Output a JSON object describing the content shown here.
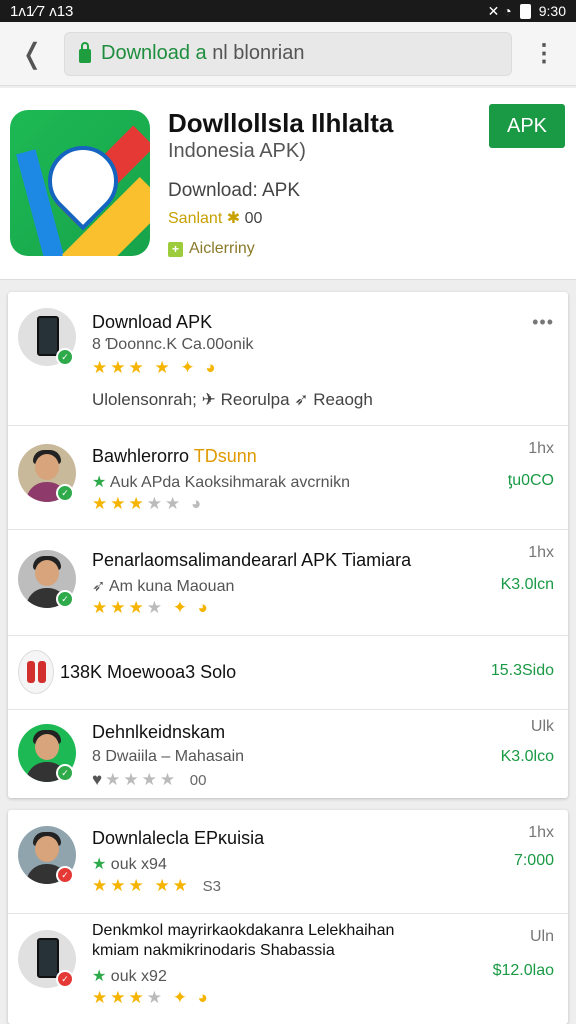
{
  "status": {
    "left": "1ʌ1∕7 ʌ13",
    "time": "9:30",
    "icons": "✕ ◔"
  },
  "urlbar": {
    "url_green": "Download a",
    "url_rest": "nl blonrian"
  },
  "app": {
    "title": "Dowllollsla Ilhlalta",
    "subtitle": "Indonesia APK)",
    "download": "Download: APK",
    "size_label": "Sanlant",
    "size_value": "00",
    "category_icon": "+",
    "category": "Aiclerriny",
    "apk_button": "APK"
  },
  "card1": {
    "menu": "•••",
    "rows": [
      {
        "title": "Download APK",
        "sub": "8 Ɗoonnc.K Ca.00onik",
        "stars_on": "★★★",
        "stars_off": "",
        "extra": "★ ✦ ◕",
        "link": "Ulolensonrah; ✈ Reorulpa ➶ Reaogh"
      },
      {
        "title_a": "Bawhlerorro",
        "title_b": "TDsunn",
        "sub_star": "★",
        "sub": "Auk APda Kaoksihmarak avcrnikn",
        "stars_on": "★★★",
        "stars_off": "★★",
        "extra": "◕",
        "time": "1hx",
        "price": "ƫu0CO"
      },
      {
        "title": "Penarlaomsalimandeararl APK Tiamiara",
        "sub": "➶ Am kuna Maouan",
        "stars_on": "★★★",
        "stars_off": "★",
        "extra": "✦ ◕",
        "time": "1hx",
        "price": "K3.0lcn"
      },
      {
        "title": "138K Moewooa3 Solo",
        "price": "15.3Sido"
      },
      {
        "title": "Dehnlkeidnskam",
        "sub": "8 Dwaiila – Mahasain",
        "stars_on": "♥",
        "stars_off": "★★★★",
        "extra": "00",
        "time": "Ulk",
        "price": "K3.0lco"
      }
    ]
  },
  "card2": {
    "rows": [
      {
        "title": "Downlalecla EPĸuisia",
        "sub_star": "★",
        "sub": "ouk x94",
        "stars_on": "★★★ ★★",
        "stars_off": "",
        "extra": "S3",
        "time": "1hx",
        "price": "7:000"
      },
      {
        "title": "Denkmkol mayrirkaokdakanra Lelekhaihan",
        "title2": "kmiam nakmikrinodaris Shabassia",
        "sub_star": "★",
        "sub": "ouk x92",
        "stars_on": "★★★",
        "stars_off": "★",
        "extra": "✦ ◕",
        "time": "Uln",
        "price": "$12.0lao"
      }
    ]
  },
  "colors": {
    "accent": "#1a9a45",
    "star": "#f4b400",
    "statusbar": "#1a1a1a"
  },
  "icons": [
    "lock-icon",
    "back-icon",
    "overflow-menu-icon",
    "battery-icon",
    "wifi-icon"
  ]
}
